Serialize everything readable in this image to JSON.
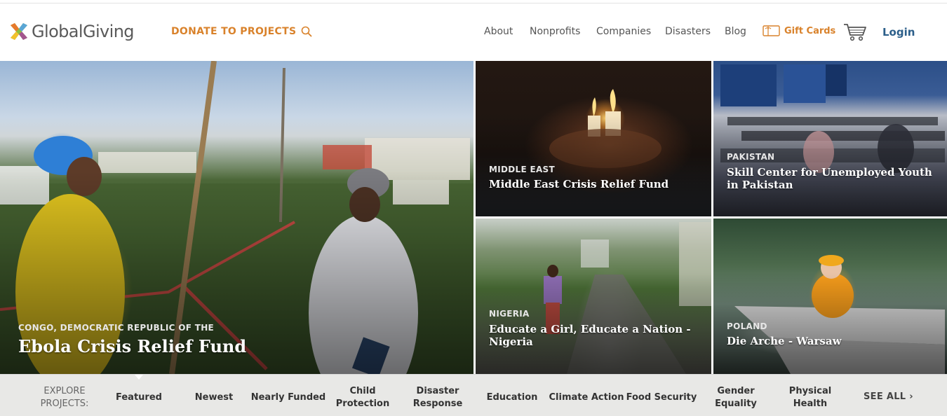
{
  "header": {
    "logo_text": "GlobalGiving",
    "donate_label": "DONATE TO PROJECTS",
    "nav": [
      "About",
      "Nonprofits",
      "Companies",
      "Disasters",
      "Blog"
    ],
    "gift_cards_label": "Gift Cards",
    "login_label": "Login"
  },
  "colors": {
    "accent_orange": "#d9822b",
    "login_blue": "#2c5f8a",
    "explore_bar": "#e8e8e6"
  },
  "icons": {
    "search": "search-icon",
    "gift_card": "gift-card-icon",
    "cart": "cart-icon"
  },
  "tiles": {
    "congo": {
      "country": "CONGO, DEMOCRATIC REPUBLIC OF THE",
      "title": "Ebola Crisis Relief Fund"
    },
    "middle_east": {
      "country": "MIDDLE EAST",
      "title": "Middle East Crisis Relief Fund"
    },
    "pakistan": {
      "country": "PAKISTAN",
      "title": "Skill Center for Unemployed Youth in Pakistan"
    },
    "nigeria": {
      "country": "NIGERIA",
      "title": "Educate a Girl, Educate a Nation - Nigeria"
    },
    "poland": {
      "country": "POLAND",
      "title": "Die Arche - Warsaw"
    }
  },
  "explore": {
    "heading": "EXPLORE PROJECTS:",
    "categories": [
      "Featured",
      "Newest",
      "Nearly Funded",
      "Child Protection",
      "Disaster Response",
      "Education",
      "Climate Action",
      "Food Security",
      "Gender Equality",
      "Physical Health"
    ],
    "see_all": "SEE ALL ›"
  }
}
